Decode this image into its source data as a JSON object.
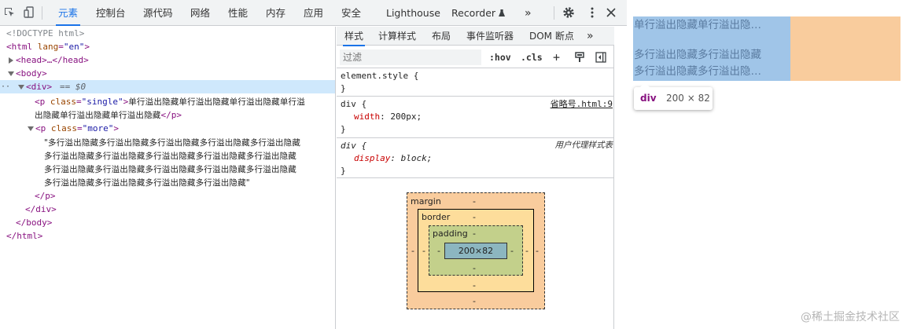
{
  "toolbar": {
    "tabs": [
      "元素",
      "控制台",
      "源代码",
      "网络",
      "性能",
      "内存",
      "应用",
      "安全",
      "Lighthouse",
      "Recorder"
    ],
    "more": "»"
  },
  "dom": {
    "doctype": "<!DOCTYPE html>",
    "html_open": "<html",
    "html_lang_attr": "lang",
    "html_lang_val": "\"en\"",
    "head": "<head>…</head>",
    "body_open": "<body>",
    "div_open": "<div>",
    "div_eq": "== $0",
    "p_single_open": "<p",
    "p_single_class_attr": "class",
    "p_single_class_val": "\"single\"",
    "p_single_text_1": "单行溢出隐藏单行溢出隐藏单行溢出隐藏单行溢",
    "p_single_text_2": "出隐藏单行溢出隐藏单行溢出隐藏",
    "p_close": "</p>",
    "p_more_open": "<p",
    "p_more_class_attr": "class",
    "p_more_class_val": "\"more\"",
    "p_more_text_1": "\"多行溢出隐藏多行溢出隐藏多行溢出隐藏多行溢出隐藏多行溢出隐藏",
    "p_more_text_2": "多行溢出隐藏多行溢出隐藏多行溢出隐藏多行溢出隐藏多行溢出隐藏",
    "p_more_text_3": "多行溢出隐藏多行溢出隐藏多行溢出隐藏多行溢出隐藏多行溢出隐藏",
    "p_more_text_4": "多行溢出隐藏多行溢出隐藏多行溢出隐藏多行溢出隐藏\"",
    "p_more_close": "</p>",
    "div_close": "</div>",
    "body_close": "</body>",
    "html_close": "</html>"
  },
  "styles": {
    "tabs": [
      "样式",
      "计算样式",
      "布局",
      "事件监听器",
      "DOM 断点"
    ],
    "more": "»",
    "filter_placeholder": "过滤",
    "hov": ":hov",
    "cls": ".cls",
    "add": "+",
    "rules": {
      "element_style_selector": "element.style {",
      "element_style_close": "}",
      "div_selector": "div {",
      "div_source": "省略号.html:9",
      "div_prop": "width",
      "div_val": "200px;",
      "div_close": "}",
      "ua_selector": "div {",
      "ua_source": "用户代理样式表",
      "ua_prop": "display",
      "ua_val": "block;",
      "ua_close": "}"
    },
    "box_model": {
      "margin_label": "margin",
      "border_label": "border",
      "padding_label": "padding",
      "content_size": "200×82",
      "dash": "-"
    }
  },
  "preview": {
    "single_line": "单行溢出隐藏单行溢出隐…",
    "multi_line_1": "多行溢出隐藏多行溢出隐藏",
    "multi_line_2": "多行溢出隐藏多行溢出隐…",
    "tooltip_tag": "div",
    "tooltip_size": "200 × 82",
    "highlight_color": "#a0c5e8",
    "margin_color": "#f9cc9d",
    "watermark": "@稀土掘金技术社区"
  },
  "colors": {
    "accent": "#1a73e8",
    "tag": "#881280",
    "attr": "#994500",
    "attr_value": "#1a1aa6",
    "css_prop": "#c80000",
    "selected_row": "#cfe8fc"
  }
}
